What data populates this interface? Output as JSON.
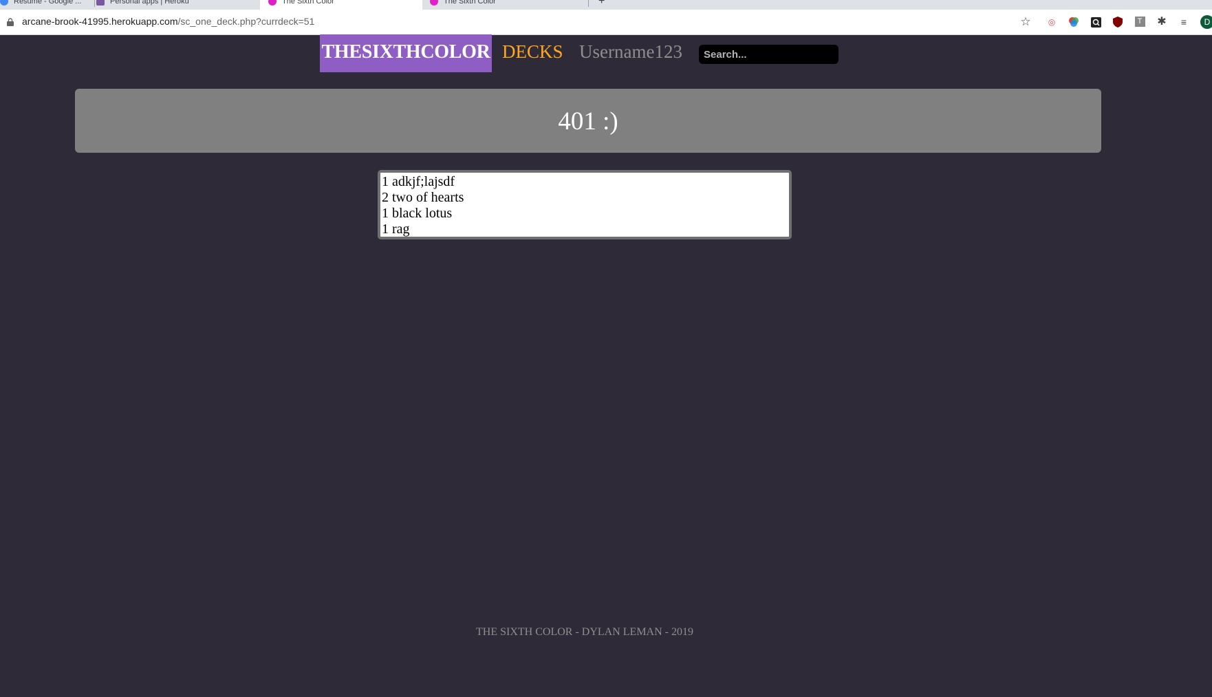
{
  "browser": {
    "tabs": [
      {
        "label": "Resume - Google ..."
      },
      {
        "label": "Personal apps | Heroku"
      },
      {
        "label": "The Sixth Color"
      },
      {
        "label": "The Sixth Color"
      }
    ],
    "url_host": "arcane-brook-41995.herokuapp.com",
    "url_path": "/sc_one_deck.php?currdeck=51",
    "profile_initial": "D"
  },
  "nav": {
    "brand": "THESIXTHCOLOR",
    "decks": "DECKS",
    "username": "Username123",
    "search_placeholder": "Search..."
  },
  "banner": {
    "title": "401 :)"
  },
  "deck": {
    "cards": [
      "1 adkjf;lajsdf",
      "2 two of hearts",
      "1 black lotus",
      "1 rag"
    ]
  },
  "footer": {
    "text": "THE SIXTH COLOR - DYLAN LEMAN - 2019"
  },
  "colors": {
    "background": "#2e2a38",
    "brand_bg": "#8f5ec4",
    "decks": "#ffa81f",
    "banner": "#808080"
  }
}
